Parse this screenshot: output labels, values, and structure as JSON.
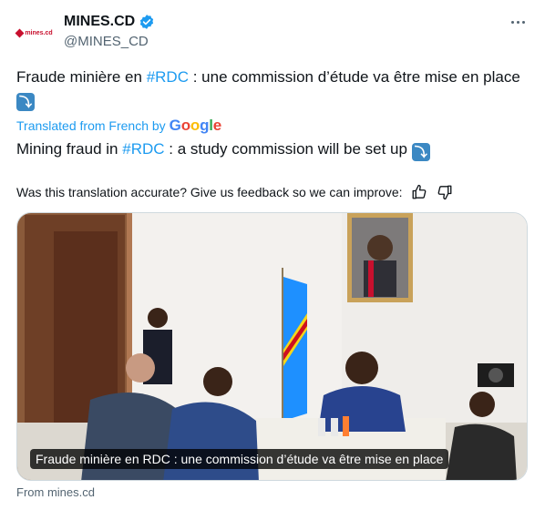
{
  "author": {
    "display_name": "MINES.CD",
    "handle": "@MINES_CD",
    "avatar_text": "mines.cd",
    "verified_icon": "verified-badge-icon"
  },
  "tweet": {
    "text_before": "Fraude minière en ",
    "hashtag": "#RDC",
    "text_after": " : une commission d’étude va être mise en place",
    "emoji": "⤵"
  },
  "translation": {
    "label": "Translated from French by",
    "provider": "Google",
    "text_before": "Mining fraud in ",
    "hashtag": "#RDC",
    "text_after": " : a study commission will be set up",
    "emoji": "⤵",
    "feedback_prompt": "Was this translation accurate? Give us feedback so we can improve:"
  },
  "media": {
    "caption": "Fraude minière en RDC : une commission d’étude va être mise en place"
  },
  "source": "From mines.cd",
  "colors": {
    "accent": "#1d9bf0",
    "text": "#0f1419",
    "muted": "#536471"
  }
}
